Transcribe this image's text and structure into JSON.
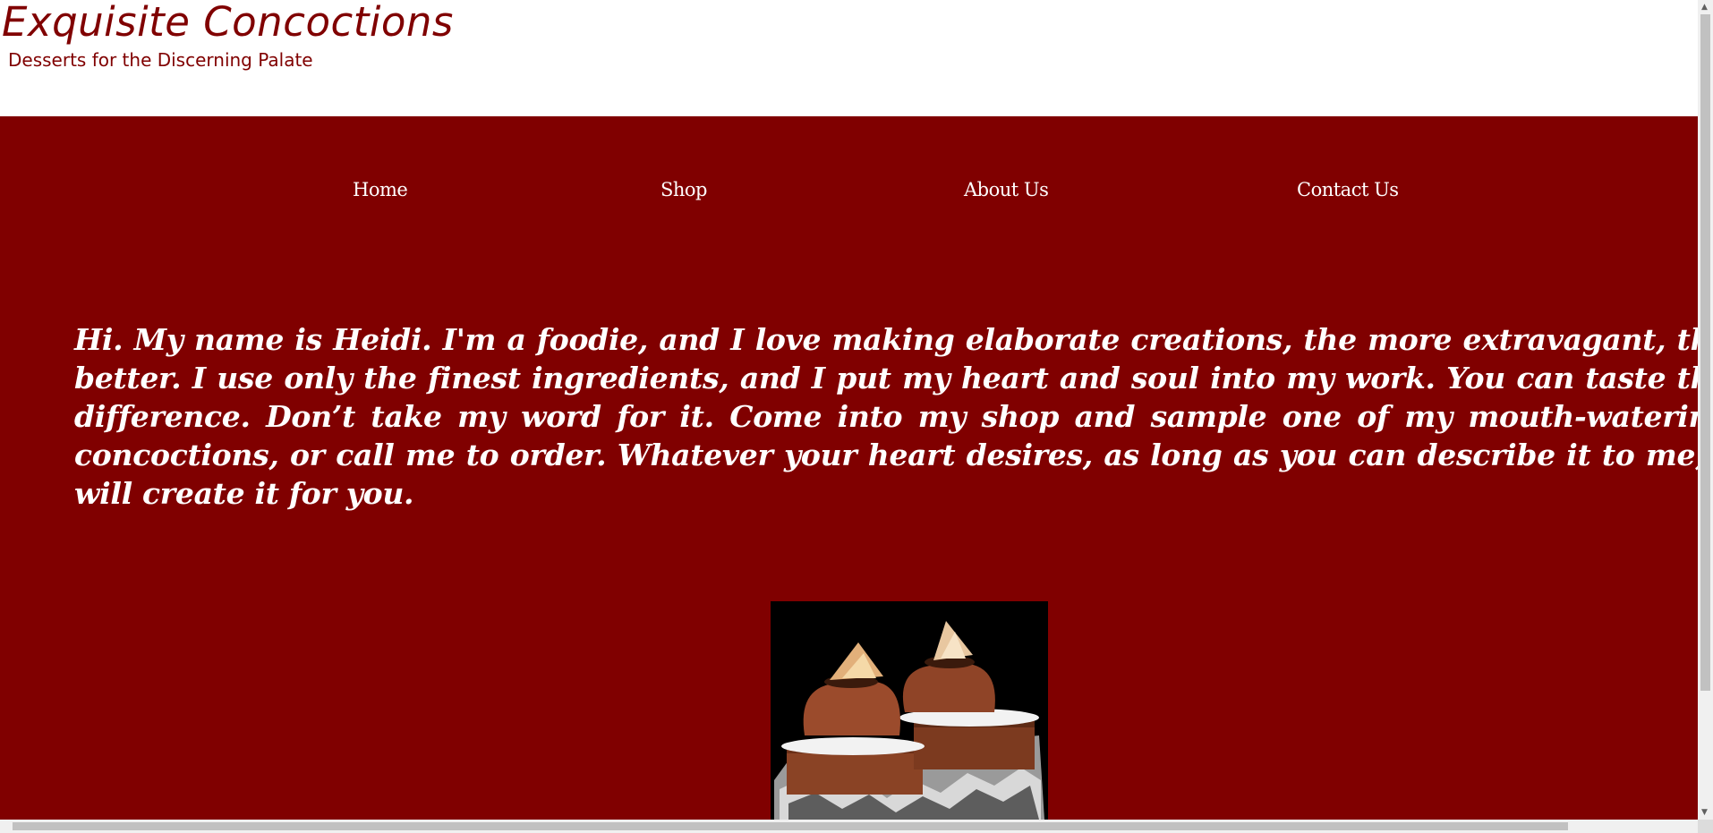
{
  "header": {
    "title": "Exquisite Concoctions",
    "tagline": "Desserts for the Discerning Palate"
  },
  "nav": {
    "items": [
      {
        "label": "Home"
      },
      {
        "label": "Shop"
      },
      {
        "label": "About Us"
      },
      {
        "label": "Contact Us"
      }
    ]
  },
  "intro": {
    "text": "Hi. My name is Heidi. I'm a foodie, and I love making elaborate creations, the more extravagant, the better. I use only the finest ingredients, and I put my heart and soul into my work. You can taste the difference. Don’t take my word for it. Come into my shop and sample one of my mouth-watering concoctions, or call me to order. Whatever your heart desires, as long as you can describe it to me, I will create it for you."
  },
  "colors": {
    "brand": "#800000",
    "text_light": "#ffffff",
    "background": "#ffffff"
  }
}
